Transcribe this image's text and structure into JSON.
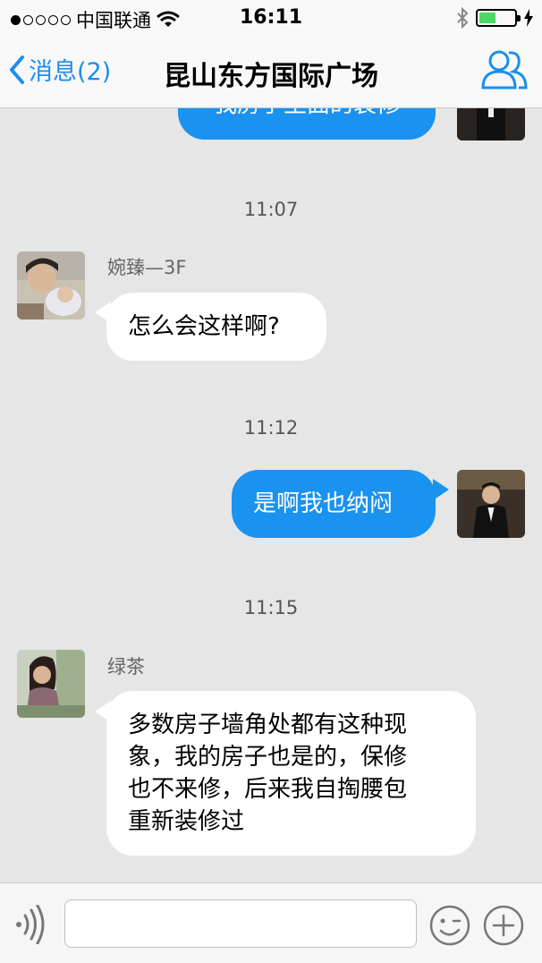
{
  "status_bar": {
    "carrier": "中国联通",
    "time": "16:11"
  },
  "nav": {
    "back_label": "消息(2)",
    "title": "昆山东方国际广场"
  },
  "messages": {
    "partial_top_text": "我房子里面的装修",
    "items": [
      {
        "time": "11:07",
        "sender": "婉臻—3F",
        "text": "怎么会这样啊?"
      },
      {
        "time": "11:12",
        "text": "是啊我也纳闷"
      },
      {
        "time": "11:15",
        "sender": "绿茶",
        "lines": [
          "多数房子墙角处都有这种现",
          "象，我的房子也是的，保修",
          "也不来修，后来我自掏腰包",
          "重新装修过"
        ]
      }
    ]
  },
  "colors": {
    "accent": "#1a8ef0",
    "outgoing_bubble": "#1a92f0",
    "incoming_bubble": "#ffffff",
    "background": "#e6e6e6",
    "battery": "#4cd964"
  },
  "icons": {
    "back": "chevron-left-icon",
    "group": "people-icon",
    "voice": "voice-icon",
    "emoji": "emoji-icon",
    "more": "plus-icon"
  }
}
